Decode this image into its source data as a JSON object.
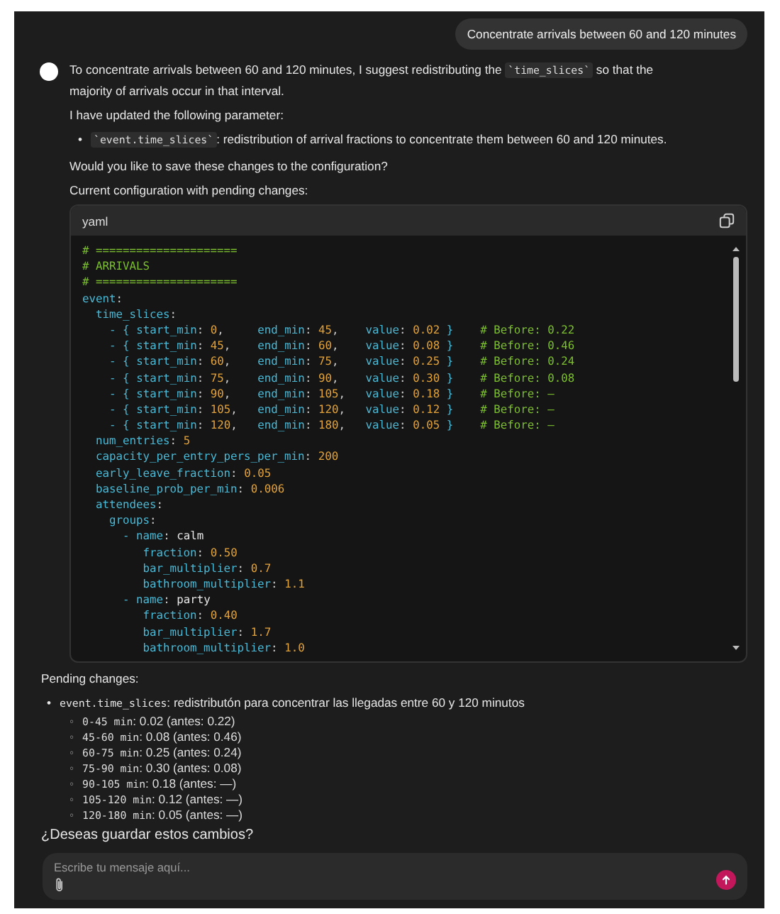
{
  "user_message": "Concentrate arrivals between 60 and 120 minutes",
  "intro": {
    "before": "To concentrate arrivals between 60 and 120 minutes, I suggest redistributing the ",
    "code": "`time_slices`",
    "after": " so that the majority of arrivals occur in that interval."
  },
  "updated_label": "I have updated the following parameter:",
  "updated_items": [
    {
      "bullet": "•",
      "code": "`event.time_slices`",
      "text": ": redistribution of arrival fractions to concentrate them between 60 and 120 minutes."
    }
  ],
  "save_question": "Would you like to save these changes to the configuration?",
  "config_label": "Current configuration with pending changes:",
  "code_block": {
    "language": "yaml",
    "lines": [
      "# =====================",
      "# ARRIVALS",
      "# =====================",
      "event:",
      "  time_slices:",
      "    - { start_min: 0,     end_min: 45,    value: 0.02 }    # Before: 0.22",
      "    - { start_min: 45,    end_min: 60,    value: 0.08 }    # Before: 0.46",
      "    - { start_min: 60,    end_min: 75,    value: 0.25 }    # Before: 0.24",
      "    - { start_min: 75,    end_min: 90,    value: 0.30 }    # Before: 0.08",
      "    - { start_min: 90,    end_min: 105,   value: 0.18 }    # Before: —",
      "    - { start_min: 105,   end_min: 120,   value: 0.12 }    # Before: —",
      "    - { start_min: 120,   end_min: 180,   value: 0.05 }    # Before: —",
      "  num_entries: 5",
      "  capacity_per_entry_pers_per_min: 200",
      "  early_leave_fraction: 0.05",
      "  baseline_prob_per_min: 0.006",
      "  attendees:",
      "    groups:",
      "      - name: calm",
      "         fraction: 0.50",
      "         bar_multiplier: 0.7",
      "         bathroom_multiplier: 1.1",
      "      - name: party",
      "         fraction: 0.40",
      "         bar_multiplier: 1.7",
      "         bathroom_multiplier: 1.0"
    ]
  },
  "pending": {
    "title": "Pending changes:",
    "items": [
      {
        "bullet": "•",
        "code": "event.time_slices",
        "text": ": redistributón para concentrar las llegadas entre 60 y 120 minutos",
        "children": [
          {
            "bullet": "◦",
            "code": "0-45 min",
            "text": ": 0.02 (antes: 0.22)"
          },
          {
            "bullet": "◦",
            "code": "45-60 min",
            "text": ": 0.08 (antes: 0.46)"
          },
          {
            "bullet": "◦",
            "code": "60-75 min",
            "text": ": 0.25 (antes: 0.24)"
          },
          {
            "bullet": "◦",
            "code": "75-90 min",
            "text": ": 0.30 (antes: 0.08)"
          },
          {
            "bullet": "◦",
            "code": "90-105 min",
            "text": ": 0.18 (antes: —)"
          },
          {
            "bullet": "◦",
            "code": "105-120 min",
            "text": ": 0.12 (antes: —)"
          },
          {
            "bullet": "◦",
            "code": "120-180 min",
            "text": ": 0.05 (antes: —)"
          }
        ]
      }
    ]
  },
  "closing_question": "¿Deseas guardar estos cambios?",
  "composer": {
    "placeholder": "Escribe tu mensaje aquí..."
  }
}
